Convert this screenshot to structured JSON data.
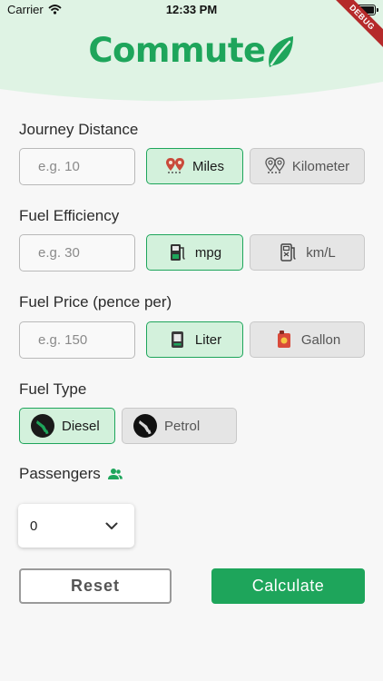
{
  "status_bar": {
    "carrier": "Carrier",
    "time": "12:33 PM"
  },
  "debug_banner": "DEBUG",
  "app": {
    "logo_text": "Commute"
  },
  "colors": {
    "brand_green": "#1ea55b",
    "selected_bg": "#d3f1dc",
    "unselected_bg": "#e5e5e5",
    "header_bg": "#dff3e4"
  },
  "distance": {
    "label": "Journey Distance",
    "placeholder": "e.g. 10",
    "units": [
      {
        "label": "Miles",
        "icon": "map-pins-icon",
        "selected": true
      },
      {
        "label": "Kilometer",
        "icon": "map-pins-outline-icon",
        "selected": false
      }
    ]
  },
  "efficiency": {
    "label": "Fuel Efficiency",
    "placeholder": "e.g. 30",
    "units": [
      {
        "label": "mpg",
        "icon": "fuel-pump-icon",
        "selected": true
      },
      {
        "label": "km/L",
        "icon": "fuel-pump-outline-icon",
        "selected": false
      }
    ]
  },
  "price": {
    "label": "Fuel Price (pence per)",
    "placeholder": "e.g. 150",
    "units": [
      {
        "label": "Liter",
        "icon": "fuel-can-icon",
        "selected": true
      },
      {
        "label": "Gallon",
        "icon": "gas-can-icon",
        "selected": false
      }
    ]
  },
  "fuel_type": {
    "label": "Fuel Type",
    "options": [
      {
        "label": "Diesel",
        "icon": "nozzle-green-icon",
        "selected": true
      },
      {
        "label": "Petrol",
        "icon": "nozzle-black-icon",
        "selected": false
      }
    ]
  },
  "passengers": {
    "label": "Passengers",
    "icon": "people-icon",
    "value": "0"
  },
  "actions": {
    "reset": "Reset",
    "calculate": "Calculate"
  }
}
